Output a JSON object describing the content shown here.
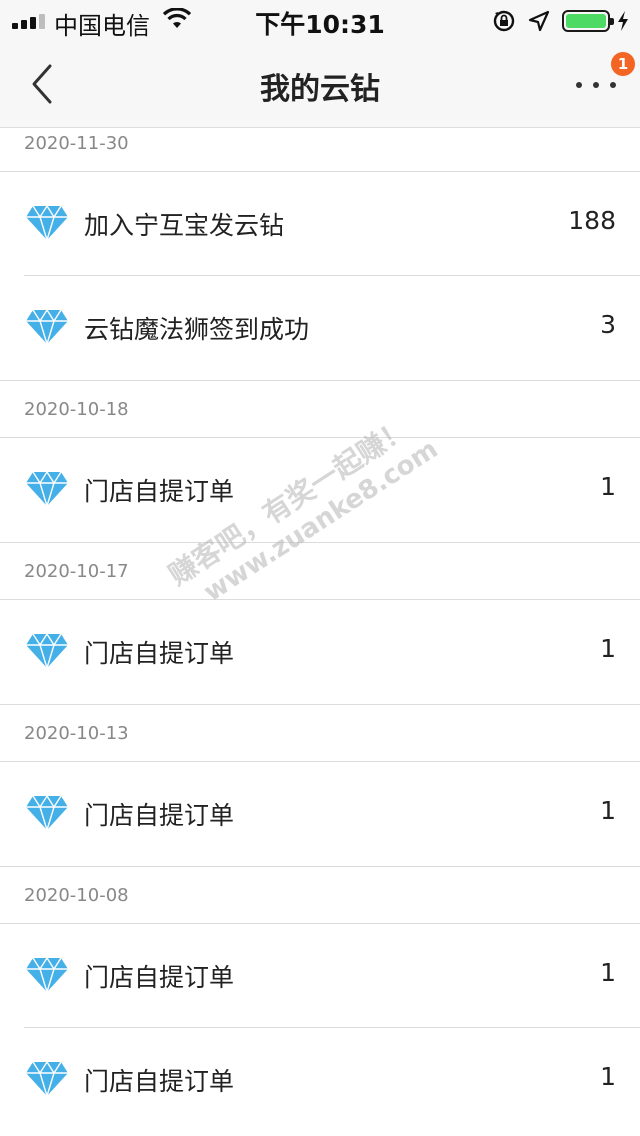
{
  "status": {
    "carrier": "中国电信",
    "time": "下午10:31",
    "signal_bars": 4,
    "signal_active": 3,
    "battery_percent": 100,
    "battery_color": "#4cd964"
  },
  "nav": {
    "title": "我的云钻",
    "badge": "1",
    "badge_color": "#f26522"
  },
  "groups": [
    {
      "date": "2020-11-30",
      "items": [
        {
          "label": "加入宁互宝发云钻",
          "value": "188"
        },
        {
          "label": "云钻魔法狮签到成功",
          "value": "3"
        }
      ]
    },
    {
      "date": "2020-10-18",
      "items": [
        {
          "label": "门店自提订单",
          "value": "1"
        }
      ]
    },
    {
      "date": "2020-10-17",
      "items": [
        {
          "label": "门店自提订单",
          "value": "1"
        }
      ]
    },
    {
      "date": "2020-10-13",
      "items": [
        {
          "label": "门店自提订单",
          "value": "1"
        }
      ]
    },
    {
      "date": "2020-10-08",
      "items": [
        {
          "label": "门店自提订单",
          "value": "1"
        },
        {
          "label": "门店自提订单",
          "value": "1"
        }
      ]
    }
  ],
  "icons": {
    "row_icon": "diamond-icon",
    "diamond_color": "#45b0e8"
  },
  "watermark": {
    "line1": "赚客吧，有奖一起赚！",
    "line2": "www.zuanke8.com"
  }
}
